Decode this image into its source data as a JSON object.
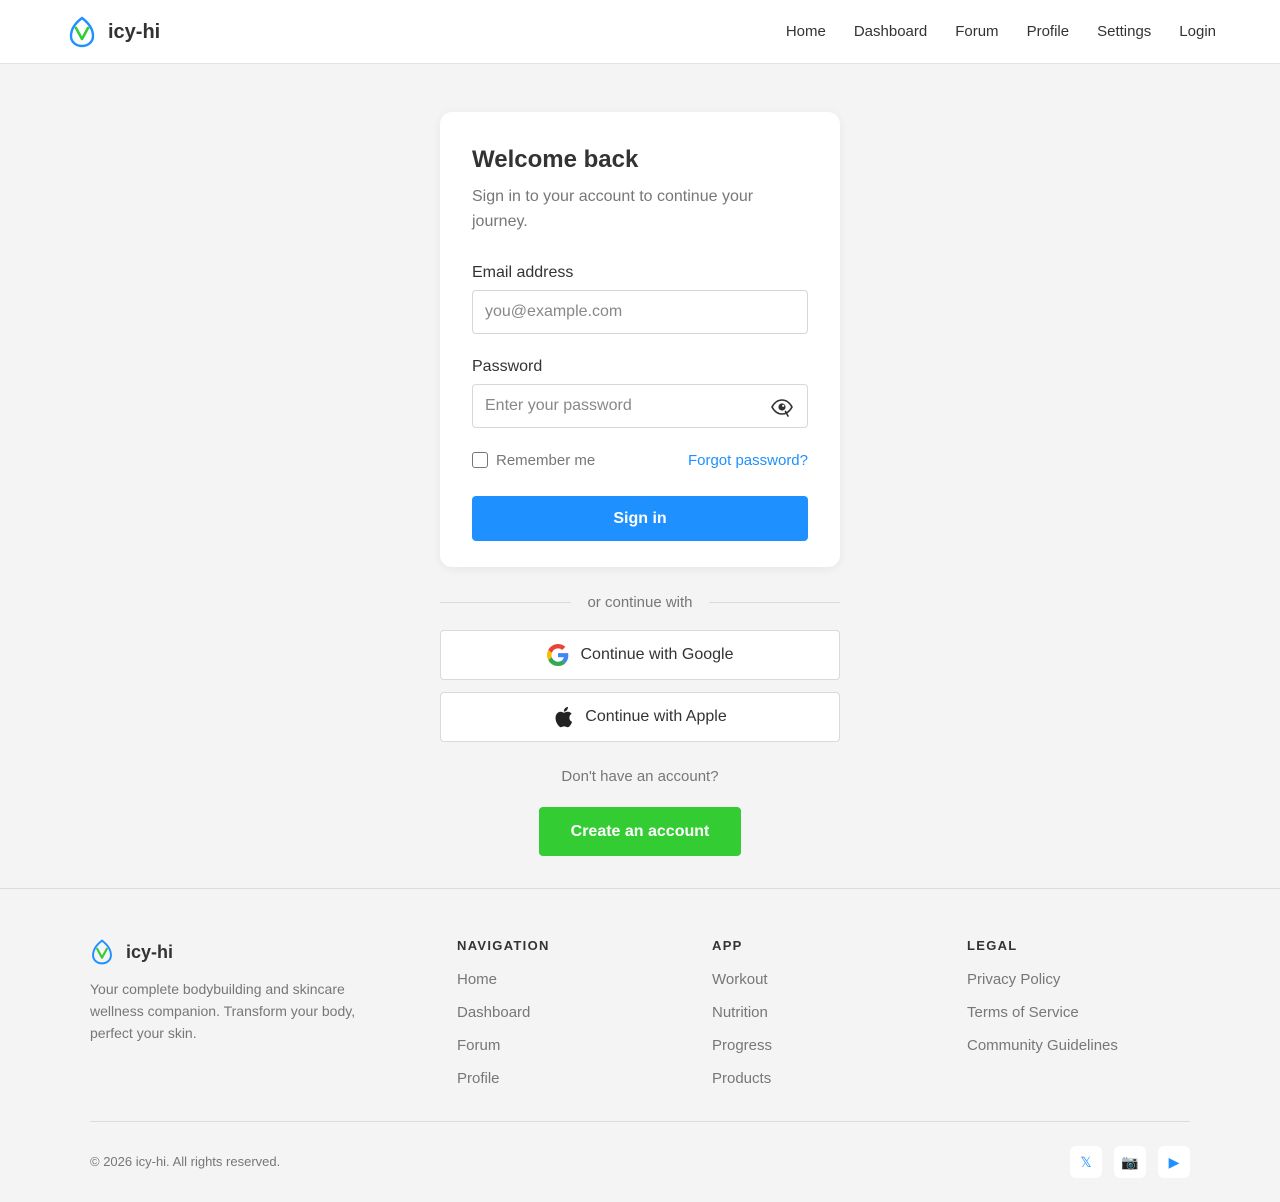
{
  "brand": {
    "name": "icy-hi",
    "logo_icon": "leaf-drop-logo"
  },
  "nav": {
    "items": [
      "Home",
      "Dashboard",
      "Forum",
      "Profile",
      "Settings",
      "Login"
    ]
  },
  "login": {
    "title": "Welcome back",
    "subtitle": "Sign in to your account to continue your journey.",
    "email_label": "Email address",
    "email_placeholder": "you@example.com",
    "email_value": "",
    "password_label": "Password",
    "password_placeholder": "Enter your password",
    "password_value": "",
    "password_toggle_icon": "eye-icon",
    "remember_label": "Remember me",
    "remember_checked": false,
    "forgot_label": "Forgot password?",
    "signin_label": "Sign in"
  },
  "social": {
    "divider": "or continue with",
    "google_label": "Continue with Google",
    "apple_label": "Continue with Apple"
  },
  "signup": {
    "prompt": "Don't have an account?",
    "button_label": "Create an account"
  },
  "footer": {
    "brand_name": "icy-hi",
    "description": "Your complete bodybuilding and skincare wellness companion. Transform your body, perfect your skin.",
    "columns": [
      {
        "heading": "NAVIGATION",
        "links": [
          "Home",
          "Dashboard",
          "Forum",
          "Profile"
        ]
      },
      {
        "heading": "APP",
        "links": [
          "Workout",
          "Nutrition",
          "Progress",
          "Products"
        ]
      },
      {
        "heading": "LEGAL",
        "links": [
          "Privacy Policy",
          "Terms of Service",
          "Community Guidelines"
        ]
      }
    ],
    "copyright": "© 2026 icy-hi. All rights reserved.",
    "social_icons": [
      "x-twitter-icon",
      "instagram-camera-icon",
      "youtube-play-icon"
    ],
    "social_glyphs": [
      "𝕏",
      "📷",
      "▶"
    ]
  },
  "colors": {
    "primary": "#1e90ff",
    "success": "#33cc33",
    "text": "#333333",
    "muted": "#777777",
    "background": "#f4f4f4",
    "logo_blue": "#1e90ff",
    "logo_green": "#33cc33"
  }
}
